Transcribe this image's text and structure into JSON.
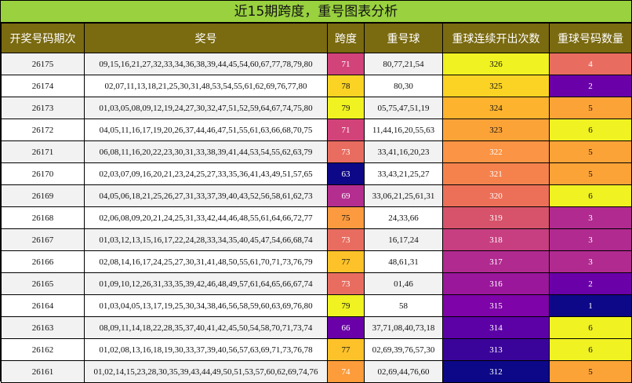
{
  "title": "近15期跨度，重号图表分析",
  "headers": [
    "开奖号码期次",
    "奖号",
    "跨度",
    "重号球",
    "重球连续开出次数",
    "重球号码数量"
  ],
  "rows": [
    {
      "period": "26175",
      "numbers": "09,15,16,21,27,32,33,34,36,38,39,44,45,54,60,67,77,78,79,80",
      "span": "71",
      "repeat": "80,77,21,54",
      "streak": "326",
      "count": "4",
      "span_bg": "#d2437a",
      "span_fg": "#ffffff",
      "streak_bg": "#f0f221",
      "streak_fg": "#111111",
      "count_bg": "#e86d60",
      "count_fg": "#ffffff"
    },
    {
      "period": "26174",
      "numbers": "02,07,11,13,18,21,25,30,31,48,53,54,55,61,62,69,76,77,80",
      "span": "78",
      "repeat": "80,30",
      "streak": "325",
      "count": "2",
      "span_bg": "#fbd324",
      "span_fg": "#111111",
      "streak_bg": "#fbd324",
      "streak_fg": "#111111",
      "count_bg": "#6a00a8",
      "count_fg": "#ffffff"
    },
    {
      "period": "26173",
      "numbers": "01,03,05,08,09,12,19,24,27,30,32,47,51,52,59,64,67,74,75,80",
      "span": "79",
      "repeat": "05,75,47,51,19",
      "streak": "324",
      "count": "5",
      "span_bg": "#f0f221",
      "span_fg": "#111111",
      "streak_bg": "#fdb32e",
      "streak_fg": "#111111",
      "count_bg": "#fca338",
      "count_fg": "#111111"
    },
    {
      "period": "26172",
      "numbers": "04,05,11,16,17,19,20,26,37,44,46,47,51,55,61,63,66,68,70,75",
      "span": "71",
      "repeat": "11,44,16,20,55,63",
      "streak": "323",
      "count": "6",
      "span_bg": "#d2437a",
      "span_fg": "#ffffff",
      "streak_bg": "#fca338",
      "streak_fg": "#111111",
      "count_bg": "#f0f221",
      "count_fg": "#111111"
    },
    {
      "period": "26171",
      "numbers": "06,08,11,16,20,22,23,30,31,33,38,39,41,44,53,54,55,62,63,79",
      "span": "73",
      "repeat": "33,41,16,20,23",
      "streak": "322",
      "count": "5",
      "span_bg": "#e86d60",
      "span_fg": "#ffffff",
      "streak_bg": "#fb9444",
      "streak_fg": "#ffffff",
      "count_bg": "#fca338",
      "count_fg": "#111111"
    },
    {
      "period": "26170",
      "numbers": "02,03,07,09,16,20,21,23,24,25,27,33,35,36,41,43,49,51,57,65",
      "span": "63",
      "repeat": "33,43,21,25,27",
      "streak": "321",
      "count": "5",
      "span_bg": "#0d0887",
      "span_fg": "#ffffff",
      "streak_bg": "#f5824d",
      "streak_fg": "#ffffff",
      "count_bg": "#fca338",
      "count_fg": "#111111"
    },
    {
      "period": "26169",
      "numbers": "04,05,06,18,21,25,26,27,31,33,37,39,40,43,52,56,58,61,62,73",
      "span": "69",
      "repeat": "33,06,21,25,61,31",
      "streak": "320",
      "count": "6",
      "span_bg": "#b42e8f",
      "span_fg": "#ffffff",
      "streak_bg": "#ec7058",
      "streak_fg": "#ffffff",
      "count_bg": "#f0f221",
      "count_fg": "#111111"
    },
    {
      "period": "26168",
      "numbers": "02,06,08,09,20,21,24,25,31,33,42,44,46,48,55,61,64,66,72,77",
      "span": "75",
      "repeat": "24,33,66",
      "streak": "319",
      "count": "3",
      "span_bg": "#fb9a3e",
      "span_fg": "#111111",
      "streak_bg": "#d6536b",
      "streak_fg": "#ffffff",
      "count_bg": "#b12a90",
      "count_fg": "#ffffff"
    },
    {
      "period": "26167",
      "numbers": "01,03,12,13,15,16,17,22,24,28,33,34,35,40,45,47,54,66,68,74",
      "span": "73",
      "repeat": "16,17,24",
      "streak": "318",
      "count": "3",
      "span_bg": "#e86d60",
      "span_fg": "#ffffff",
      "streak_bg": "#c83f81",
      "streak_fg": "#ffffff",
      "count_bg": "#b12a90",
      "count_fg": "#ffffff"
    },
    {
      "period": "26166",
      "numbers": "02,08,14,16,17,24,25,27,30,31,41,48,50,55,61,70,71,73,76,79",
      "span": "77",
      "repeat": "48,61,31",
      "streak": "317",
      "count": "3",
      "span_bg": "#fdc229",
      "span_fg": "#111111",
      "streak_bg": "#b12a90",
      "streak_fg": "#ffffff",
      "count_bg": "#b12a90",
      "count_fg": "#ffffff"
    },
    {
      "period": "26165",
      "numbers": "01,09,10,12,26,31,33,35,39,42,46,48,49,57,61,64,65,66,67,74",
      "span": "73",
      "repeat": "01,46",
      "streak": "316",
      "count": "2",
      "span_bg": "#e86d60",
      "span_fg": "#ffffff",
      "streak_bg": "#9a179b",
      "streak_fg": "#ffffff",
      "count_bg": "#6a00a8",
      "count_fg": "#ffffff"
    },
    {
      "period": "26164",
      "numbers": "01,03,04,05,13,17,19,25,30,34,38,46,56,58,59,60,63,69,76,80",
      "span": "79",
      "repeat": "58",
      "streak": "315",
      "count": "1",
      "span_bg": "#f0f221",
      "span_fg": "#111111",
      "streak_bg": "#7e03a8",
      "streak_fg": "#ffffff",
      "count_bg": "#0d0887",
      "count_fg": "#ffffff"
    },
    {
      "period": "26163",
      "numbers": "08,09,11,14,18,22,28,35,37,40,41,42,45,50,54,58,70,71,73,74",
      "span": "66",
      "repeat": "37,71,08,40,73,18",
      "streak": "314",
      "count": "6",
      "span_bg": "#6a00a8",
      "span_fg": "#ffffff",
      "streak_bg": "#5c01a6",
      "streak_fg": "#ffffff",
      "count_bg": "#f0f221",
      "count_fg": "#111111"
    },
    {
      "period": "26162",
      "numbers": "01,02,08,13,16,18,19,30,33,37,39,40,56,57,63,69,71,73,76,78",
      "span": "77",
      "repeat": "02,69,39,76,57,30",
      "streak": "313",
      "count": "6",
      "span_bg": "#fdc229",
      "span_fg": "#111111",
      "streak_bg": "#3a049a",
      "streak_fg": "#ffffff",
      "count_bg": "#f0f221",
      "count_fg": "#111111"
    },
    {
      "period": "26161",
      "numbers": "01,02,14,15,23,28,30,35,39,43,44,49,50,51,53,57,60,62,69,74,76",
      "span": "74",
      "repeat": "02,69,44,76,60",
      "streak": "312",
      "count": "5",
      "span_bg": "#fc9c3b",
      "span_fg": "#ffffff",
      "streak_bg": "#0d0887",
      "streak_fg": "#ffffff",
      "count_bg": "#fca338",
      "count_fg": "#111111"
    }
  ]
}
